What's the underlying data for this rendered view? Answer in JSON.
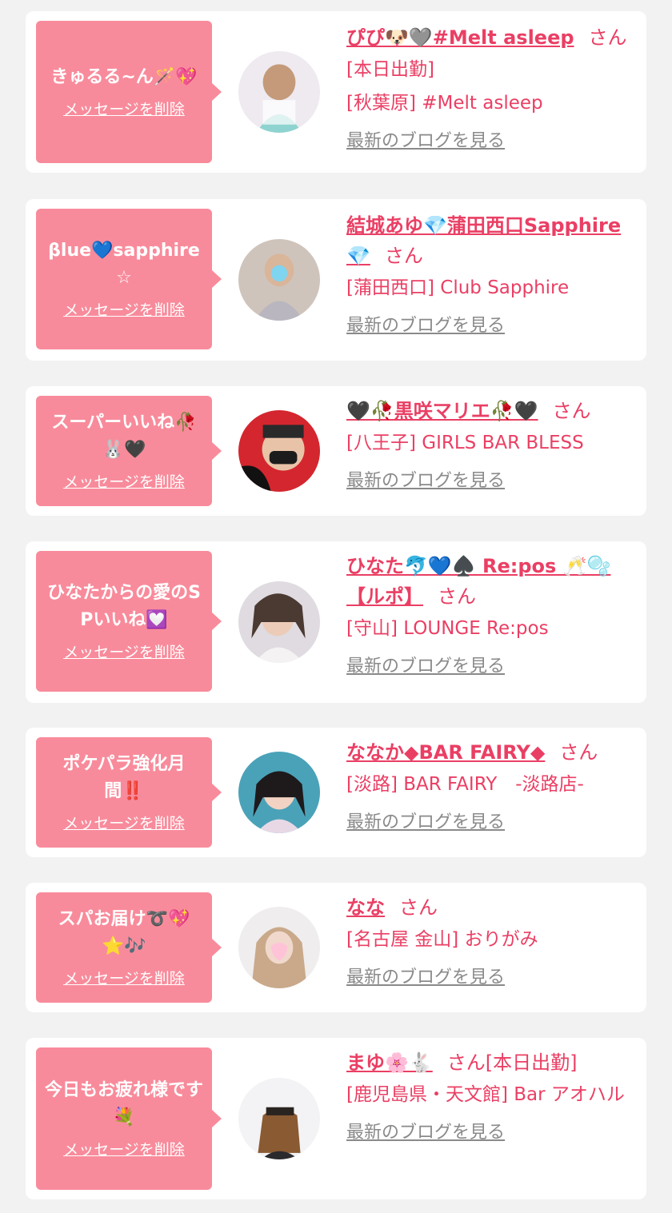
{
  "colors": {
    "background": "#f2f2f2",
    "card": "#ffffff",
    "bubble": "#f88b9b",
    "accent": "#ea3f64",
    "muted": "#8a8a8a"
  },
  "labels": {
    "delete_message": "メッセージを削除",
    "latest_blog": "最新のブログを見る",
    "honorific": "さん"
  },
  "items": [
    {
      "message": "きゅるる~ん🪄💖",
      "name": "ぴぴ🐶🩶#Melt asleep",
      "name_suffix": "",
      "lines": [
        "[本日出勤]",
        "[秋葉原] #Melt asleep"
      ]
    },
    {
      "message": "βlue💙sapphire☆",
      "name": "結城あゆ💎蒲田西口Sapphire💎",
      "name_suffix": "",
      "lines": [
        "[蒲田西口] Club Sapphire"
      ]
    },
    {
      "message": "スーパーいいね🥀🐰🖤",
      "name": "🖤🥀黒咲マリエ🥀🖤",
      "name_suffix": "",
      "lines": [
        "[八王子] GIRLS BAR BLESS"
      ]
    },
    {
      "message": "ひなたからの愛のSPいいね💟",
      "name": "ひなた🐬💙♠️ Re:pos 🥂🫧【ルポ】",
      "name_suffix": "",
      "lines": [
        "[守山] LOUNGE Re:pos"
      ]
    },
    {
      "message": "ポケパラ強化月間‼️",
      "name": "ななか◆BAR FAIRY◆",
      "name_suffix": "",
      "lines": [
        "[淡路] BAR FAIRY　-淡路店-"
      ]
    },
    {
      "message": "スパお届け➰💖⭐🎶",
      "name": "なな",
      "name_suffix": "",
      "lines": [
        "[名古屋 金山] おりがみ"
      ]
    },
    {
      "message": "今日もお疲れ様です💐",
      "name": "まゆ🌸🐇",
      "name_suffix": "[本日出勤]",
      "lines": [
        "[鹿児島県・天文館] Bar アオハル"
      ]
    }
  ]
}
